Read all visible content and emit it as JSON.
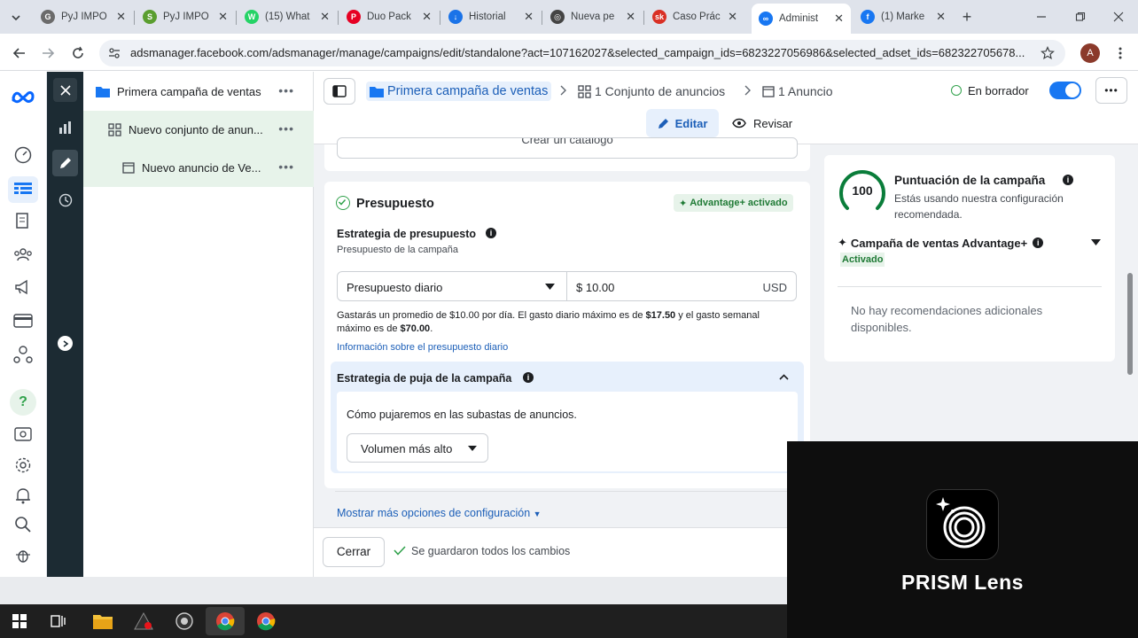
{
  "browser": {
    "tabs": [
      {
        "title": "PyJ IMPO",
        "color": "#6b6b6b",
        "glyph": "G"
      },
      {
        "title": "PyJ IMPO",
        "color": "#5a9e2f",
        "glyph": "S"
      },
      {
        "title": "(15) What",
        "color": "#25d366",
        "glyph": "W"
      },
      {
        "title": "Duo Pack",
        "color": "#e60023",
        "glyph": "P"
      },
      {
        "title": "Historial",
        "color": "#1a73e8",
        "glyph": "↓"
      },
      {
        "title": "Nueva pe",
        "color": "#444",
        "glyph": "◎"
      },
      {
        "title": "Caso Prác",
        "color": "#d93025",
        "glyph": "sk"
      },
      {
        "title": "Administ",
        "color": "#1877f2",
        "glyph": "∞",
        "active": true
      },
      {
        "title": "(1) Marke",
        "color": "#1877f2",
        "glyph": "f"
      }
    ],
    "url": "adsmanager.facebook.com/adsmanager/manage/campaigns/edit/standalone?act=107162027&selected_campaign_ids=6823227056986&selected_adset_ids=682322705678...",
    "profile_initial": "A"
  },
  "tree": {
    "campaign": "Primera campaña de ventas",
    "adset": "Nuevo conjunto de anun...",
    "ad": "Nuevo anuncio de Ve..."
  },
  "header": {
    "crumb_campaign": "Primera campaña de ventas",
    "crumb_adset": "1 Conjunto de anuncios",
    "crumb_ad": "1 Anuncio",
    "status": "En borrador",
    "edit_label": "Editar",
    "review_label": "Revisar"
  },
  "catalog_button": "Crear un catálogo",
  "budget": {
    "title": "Presupuesto",
    "advantage_badge": "Advantage+ activado",
    "strategy_label": "Estrategia de presupuesto",
    "strategy_sub": "Presupuesto de la campaña",
    "type_value": "Presupuesto diario",
    "amount_value": "$ 10.00",
    "currency": "USD",
    "note_line1_a": "Gastarás un promedio de $10.00 por día. El gasto diario máximo es de ",
    "note_max_daily": "$17.50",
    "note_line1_b": " y el gasto semanal",
    "note_line2_a": "máximo es de ",
    "note_max_weekly": "$70.00",
    "note_line2_b": ".",
    "info_link": "Información sobre el presupuesto diario"
  },
  "bid": {
    "title": "Estrategia de puja de la campaña",
    "question": "Cómo pujaremos en las subastas de anuncios.",
    "value": "Volumen más alto",
    "more_options": "Mostrar más opciones de configuración"
  },
  "footer": {
    "close_label": "Cerrar",
    "saved_text": "Se guardaron todos los cambios"
  },
  "score": {
    "value": "100",
    "title": "Puntuación de la campaña",
    "desc_line1": "Estás usando nuestra configuración",
    "desc_line2": "recomendada.",
    "advantage_title": "Campaña de ventas Advantage+",
    "advantage_status": "Activado",
    "no_recs_line1": "No hay recomendaciones adicionales",
    "no_recs_line2": "disponibles."
  },
  "overlay": {
    "brand": "PRISM Lens"
  },
  "colors": {
    "accent": "#1877f2",
    "green": "#31a24c",
    "dark_rail": "#1c2b33"
  }
}
